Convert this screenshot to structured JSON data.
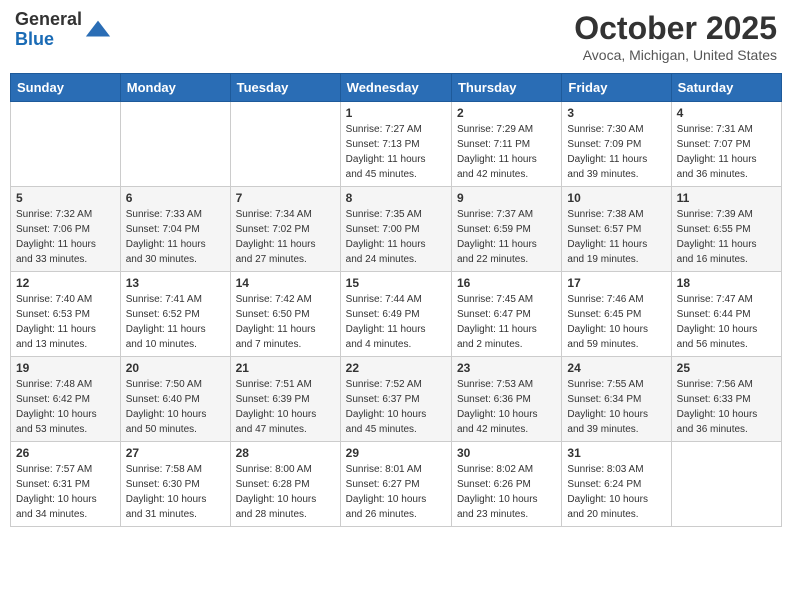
{
  "header": {
    "logo_general": "General",
    "logo_blue": "Blue",
    "month_title": "October 2025",
    "location": "Avoca, Michigan, United States"
  },
  "days_of_week": [
    "Sunday",
    "Monday",
    "Tuesday",
    "Wednesday",
    "Thursday",
    "Friday",
    "Saturday"
  ],
  "weeks": [
    [
      {
        "day": "",
        "info": ""
      },
      {
        "day": "",
        "info": ""
      },
      {
        "day": "",
        "info": ""
      },
      {
        "day": "1",
        "info": "Sunrise: 7:27 AM\nSunset: 7:13 PM\nDaylight: 11 hours\nand 45 minutes."
      },
      {
        "day": "2",
        "info": "Sunrise: 7:29 AM\nSunset: 7:11 PM\nDaylight: 11 hours\nand 42 minutes."
      },
      {
        "day": "3",
        "info": "Sunrise: 7:30 AM\nSunset: 7:09 PM\nDaylight: 11 hours\nand 39 minutes."
      },
      {
        "day": "4",
        "info": "Sunrise: 7:31 AM\nSunset: 7:07 PM\nDaylight: 11 hours\nand 36 minutes."
      }
    ],
    [
      {
        "day": "5",
        "info": "Sunrise: 7:32 AM\nSunset: 7:06 PM\nDaylight: 11 hours\nand 33 minutes."
      },
      {
        "day": "6",
        "info": "Sunrise: 7:33 AM\nSunset: 7:04 PM\nDaylight: 11 hours\nand 30 minutes."
      },
      {
        "day": "7",
        "info": "Sunrise: 7:34 AM\nSunset: 7:02 PM\nDaylight: 11 hours\nand 27 minutes."
      },
      {
        "day": "8",
        "info": "Sunrise: 7:35 AM\nSunset: 7:00 PM\nDaylight: 11 hours\nand 24 minutes."
      },
      {
        "day": "9",
        "info": "Sunrise: 7:37 AM\nSunset: 6:59 PM\nDaylight: 11 hours\nand 22 minutes."
      },
      {
        "day": "10",
        "info": "Sunrise: 7:38 AM\nSunset: 6:57 PM\nDaylight: 11 hours\nand 19 minutes."
      },
      {
        "day": "11",
        "info": "Sunrise: 7:39 AM\nSunset: 6:55 PM\nDaylight: 11 hours\nand 16 minutes."
      }
    ],
    [
      {
        "day": "12",
        "info": "Sunrise: 7:40 AM\nSunset: 6:53 PM\nDaylight: 11 hours\nand 13 minutes."
      },
      {
        "day": "13",
        "info": "Sunrise: 7:41 AM\nSunset: 6:52 PM\nDaylight: 11 hours\nand 10 minutes."
      },
      {
        "day": "14",
        "info": "Sunrise: 7:42 AM\nSunset: 6:50 PM\nDaylight: 11 hours\nand 7 minutes."
      },
      {
        "day": "15",
        "info": "Sunrise: 7:44 AM\nSunset: 6:49 PM\nDaylight: 11 hours\nand 4 minutes."
      },
      {
        "day": "16",
        "info": "Sunrise: 7:45 AM\nSunset: 6:47 PM\nDaylight: 11 hours\nand 2 minutes."
      },
      {
        "day": "17",
        "info": "Sunrise: 7:46 AM\nSunset: 6:45 PM\nDaylight: 10 hours\nand 59 minutes."
      },
      {
        "day": "18",
        "info": "Sunrise: 7:47 AM\nSunset: 6:44 PM\nDaylight: 10 hours\nand 56 minutes."
      }
    ],
    [
      {
        "day": "19",
        "info": "Sunrise: 7:48 AM\nSunset: 6:42 PM\nDaylight: 10 hours\nand 53 minutes."
      },
      {
        "day": "20",
        "info": "Sunrise: 7:50 AM\nSunset: 6:40 PM\nDaylight: 10 hours\nand 50 minutes."
      },
      {
        "day": "21",
        "info": "Sunrise: 7:51 AM\nSunset: 6:39 PM\nDaylight: 10 hours\nand 47 minutes."
      },
      {
        "day": "22",
        "info": "Sunrise: 7:52 AM\nSunset: 6:37 PM\nDaylight: 10 hours\nand 45 minutes."
      },
      {
        "day": "23",
        "info": "Sunrise: 7:53 AM\nSunset: 6:36 PM\nDaylight: 10 hours\nand 42 minutes."
      },
      {
        "day": "24",
        "info": "Sunrise: 7:55 AM\nSunset: 6:34 PM\nDaylight: 10 hours\nand 39 minutes."
      },
      {
        "day": "25",
        "info": "Sunrise: 7:56 AM\nSunset: 6:33 PM\nDaylight: 10 hours\nand 36 minutes."
      }
    ],
    [
      {
        "day": "26",
        "info": "Sunrise: 7:57 AM\nSunset: 6:31 PM\nDaylight: 10 hours\nand 34 minutes."
      },
      {
        "day": "27",
        "info": "Sunrise: 7:58 AM\nSunset: 6:30 PM\nDaylight: 10 hours\nand 31 minutes."
      },
      {
        "day": "28",
        "info": "Sunrise: 8:00 AM\nSunset: 6:28 PM\nDaylight: 10 hours\nand 28 minutes."
      },
      {
        "day": "29",
        "info": "Sunrise: 8:01 AM\nSunset: 6:27 PM\nDaylight: 10 hours\nand 26 minutes."
      },
      {
        "day": "30",
        "info": "Sunrise: 8:02 AM\nSunset: 6:26 PM\nDaylight: 10 hours\nand 23 minutes."
      },
      {
        "day": "31",
        "info": "Sunrise: 8:03 AM\nSunset: 6:24 PM\nDaylight: 10 hours\nand 20 minutes."
      },
      {
        "day": "",
        "info": ""
      }
    ]
  ]
}
